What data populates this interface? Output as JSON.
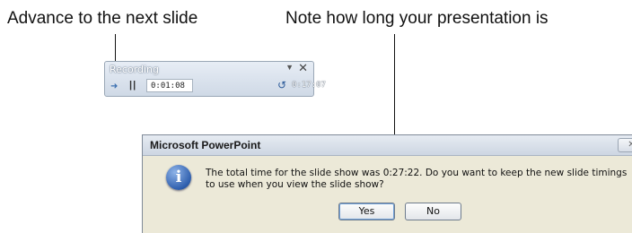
{
  "callouts": {
    "left": "Advance to the next slide",
    "right": "Note how long your presentation is"
  },
  "recording_toolbar": {
    "title": "Recording",
    "current_time": "0:01:08",
    "total_time": "0:17:07",
    "icons": [
      "next-arrow-icon",
      "pause-icon",
      "repeat-icon",
      "pin-icon",
      "close-icon"
    ]
  },
  "dialog": {
    "title": "Microsoft PowerPoint",
    "message": "The total time for the slide show was 0:27:22. Do you want to keep the new slide timings to use when you view the slide show?",
    "buttons": {
      "yes": "Yes",
      "no": "No"
    },
    "icon": "info-icon"
  }
}
